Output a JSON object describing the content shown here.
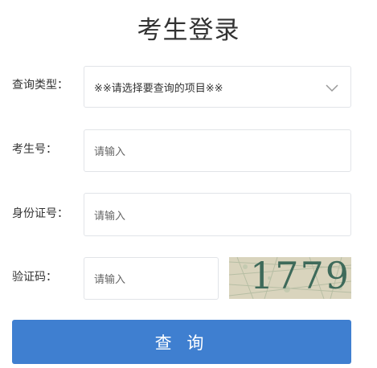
{
  "form": {
    "title": "考生登录",
    "query_type": {
      "label": "查询类型：",
      "selected": "※※请选择要查询的项目※※"
    },
    "candidate_number": {
      "label": "考生号：",
      "placeholder": "请输入"
    },
    "id_number": {
      "label": "身份证号：",
      "placeholder": "请输入"
    },
    "captcha": {
      "label": "验证码：",
      "placeholder": "请输入",
      "image_text": "1779"
    },
    "submit_label": "查 询"
  },
  "colors": {
    "submit_bg": "#3f7fd0",
    "border": "#e1e4e8",
    "text": "#333333"
  },
  "icons": {
    "select_arrow": "chevron-down-icon"
  }
}
